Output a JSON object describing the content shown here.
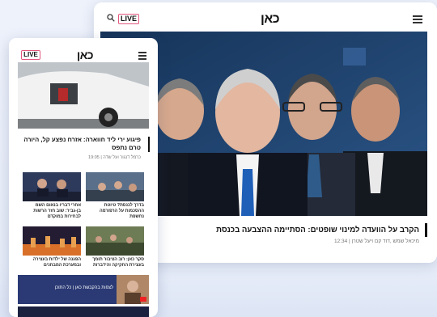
{
  "desktop": {
    "live_label": "LIVE",
    "logo_text": "כאן",
    "headline": "הקרב על הוועדה למינוי שופטים: הסתיימה ההצבעה בכנסת",
    "byline": "מיכאל שמש ,דוד קם ויעל שטרן | 12:34",
    "icons": [
      "search-icon",
      "hamburger-menu-icon"
    ]
  },
  "mobile": {
    "live_label": "LIVE",
    "logo_text": "כאן",
    "headline": "פיגוע ירי ליד חווארה: אזרח נפצע קל, היורה טרם נתפס",
    "byline": "כרמל דנגור ועל שדה | 19:05",
    "cards": [
      {
        "caption": "בדרך לכנסת? טיוטת ההסכמות על הרפורמה נחשפת"
      },
      {
        "caption": "אחרי דבריו בנאום השמ בן-גביר: שוב חזר הרשות לבחירות במוקדם"
      },
      {
        "caption": "סקר כאן: רוב הציבור תומך בעצירת החקיקה והידברות"
      },
      {
        "caption": "הפגנה של ילדות בעצירה ובמערכת המבחנים"
      }
    ],
    "banner_text": "לצפות בהקבשת כאן | כל התוכן",
    "icons": [
      "hamburger-menu-icon",
      "youtube-play-icon"
    ]
  },
  "colors": {
    "live_border": "#e4577d",
    "banner": "#2b3a75",
    "hero_bg": "#1c3e6a"
  }
}
